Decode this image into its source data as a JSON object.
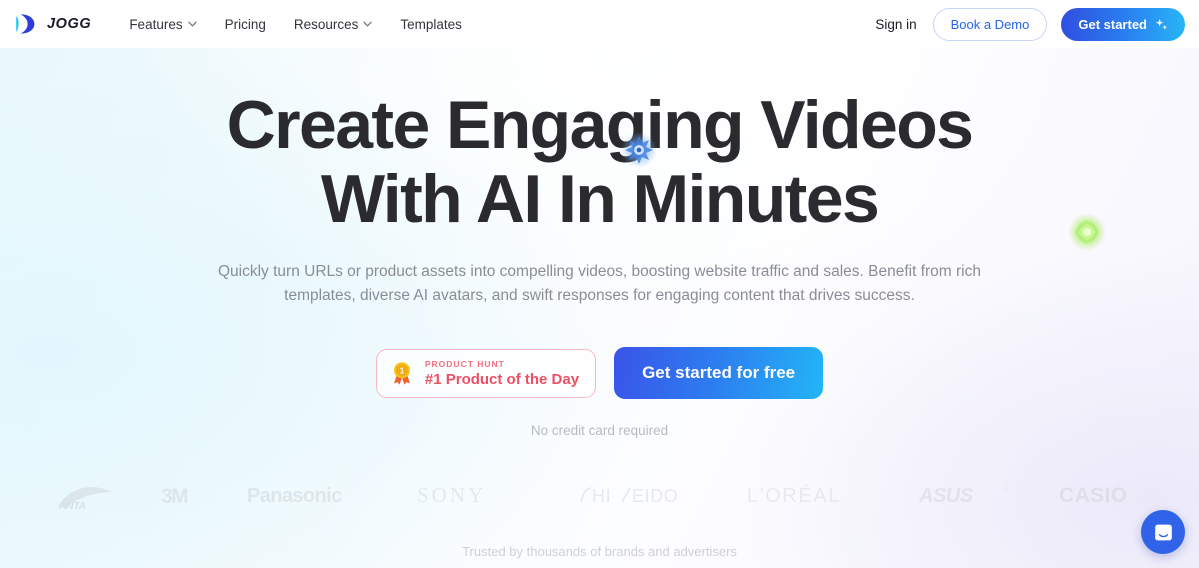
{
  "nav": {
    "logo_text": "JOGG",
    "logo_icon": "jogg-logo-icon",
    "links": [
      {
        "label": "Features",
        "has_caret": true
      },
      {
        "label": "Pricing",
        "has_caret": false
      },
      {
        "label": "Resources",
        "has_caret": true
      },
      {
        "label": "Templates",
        "has_caret": false
      }
    ],
    "signin_label": "Sign in",
    "demo_label": "Book a Demo",
    "getstarted_label": "Get started",
    "getstarted_icon": "sparkle-icon"
  },
  "hero": {
    "heading_line1": "Create Engaging Videos",
    "heading_line2": "With AI In Minutes",
    "decor_blue": "blue-sparkle-burst",
    "decor_green": "green-glow-blob",
    "subheading": "Quickly turn URLs or product assets into compelling videos, boosting website traffic and sales. Benefit from rich templates, diverse AI avatars, and swift responses for engaging content that drives success.",
    "product_hunt": {
      "icon": "gold-medal-icon",
      "kicker": "PRODUCT HUNT",
      "title": "#1 Product of the Day"
    },
    "cta_label": "Get started for free",
    "no_card_label": "No credit card required"
  },
  "brands": {
    "logos": [
      {
        "name": "ANTA"
      },
      {
        "name": "3M"
      },
      {
        "name": "Panasonic"
      },
      {
        "name": "SONY"
      },
      {
        "name": "SHISEIDO"
      },
      {
        "name": "L'ORÉAL"
      },
      {
        "name": "ASUS"
      },
      {
        "name": "CASIO"
      }
    ],
    "trusted_label": "Trusted by thousands of brands and advertisers"
  },
  "chat": {
    "icon": "chat-bubble-icon"
  },
  "colors": {
    "accent_blue": "#2563eb",
    "gradient_start": "#2f4fe0",
    "gradient_end": "#27b6f7",
    "product_hunt_red": "#ef4f63",
    "heading": "#2b2b2f",
    "muted_text": "#8a8d96"
  }
}
